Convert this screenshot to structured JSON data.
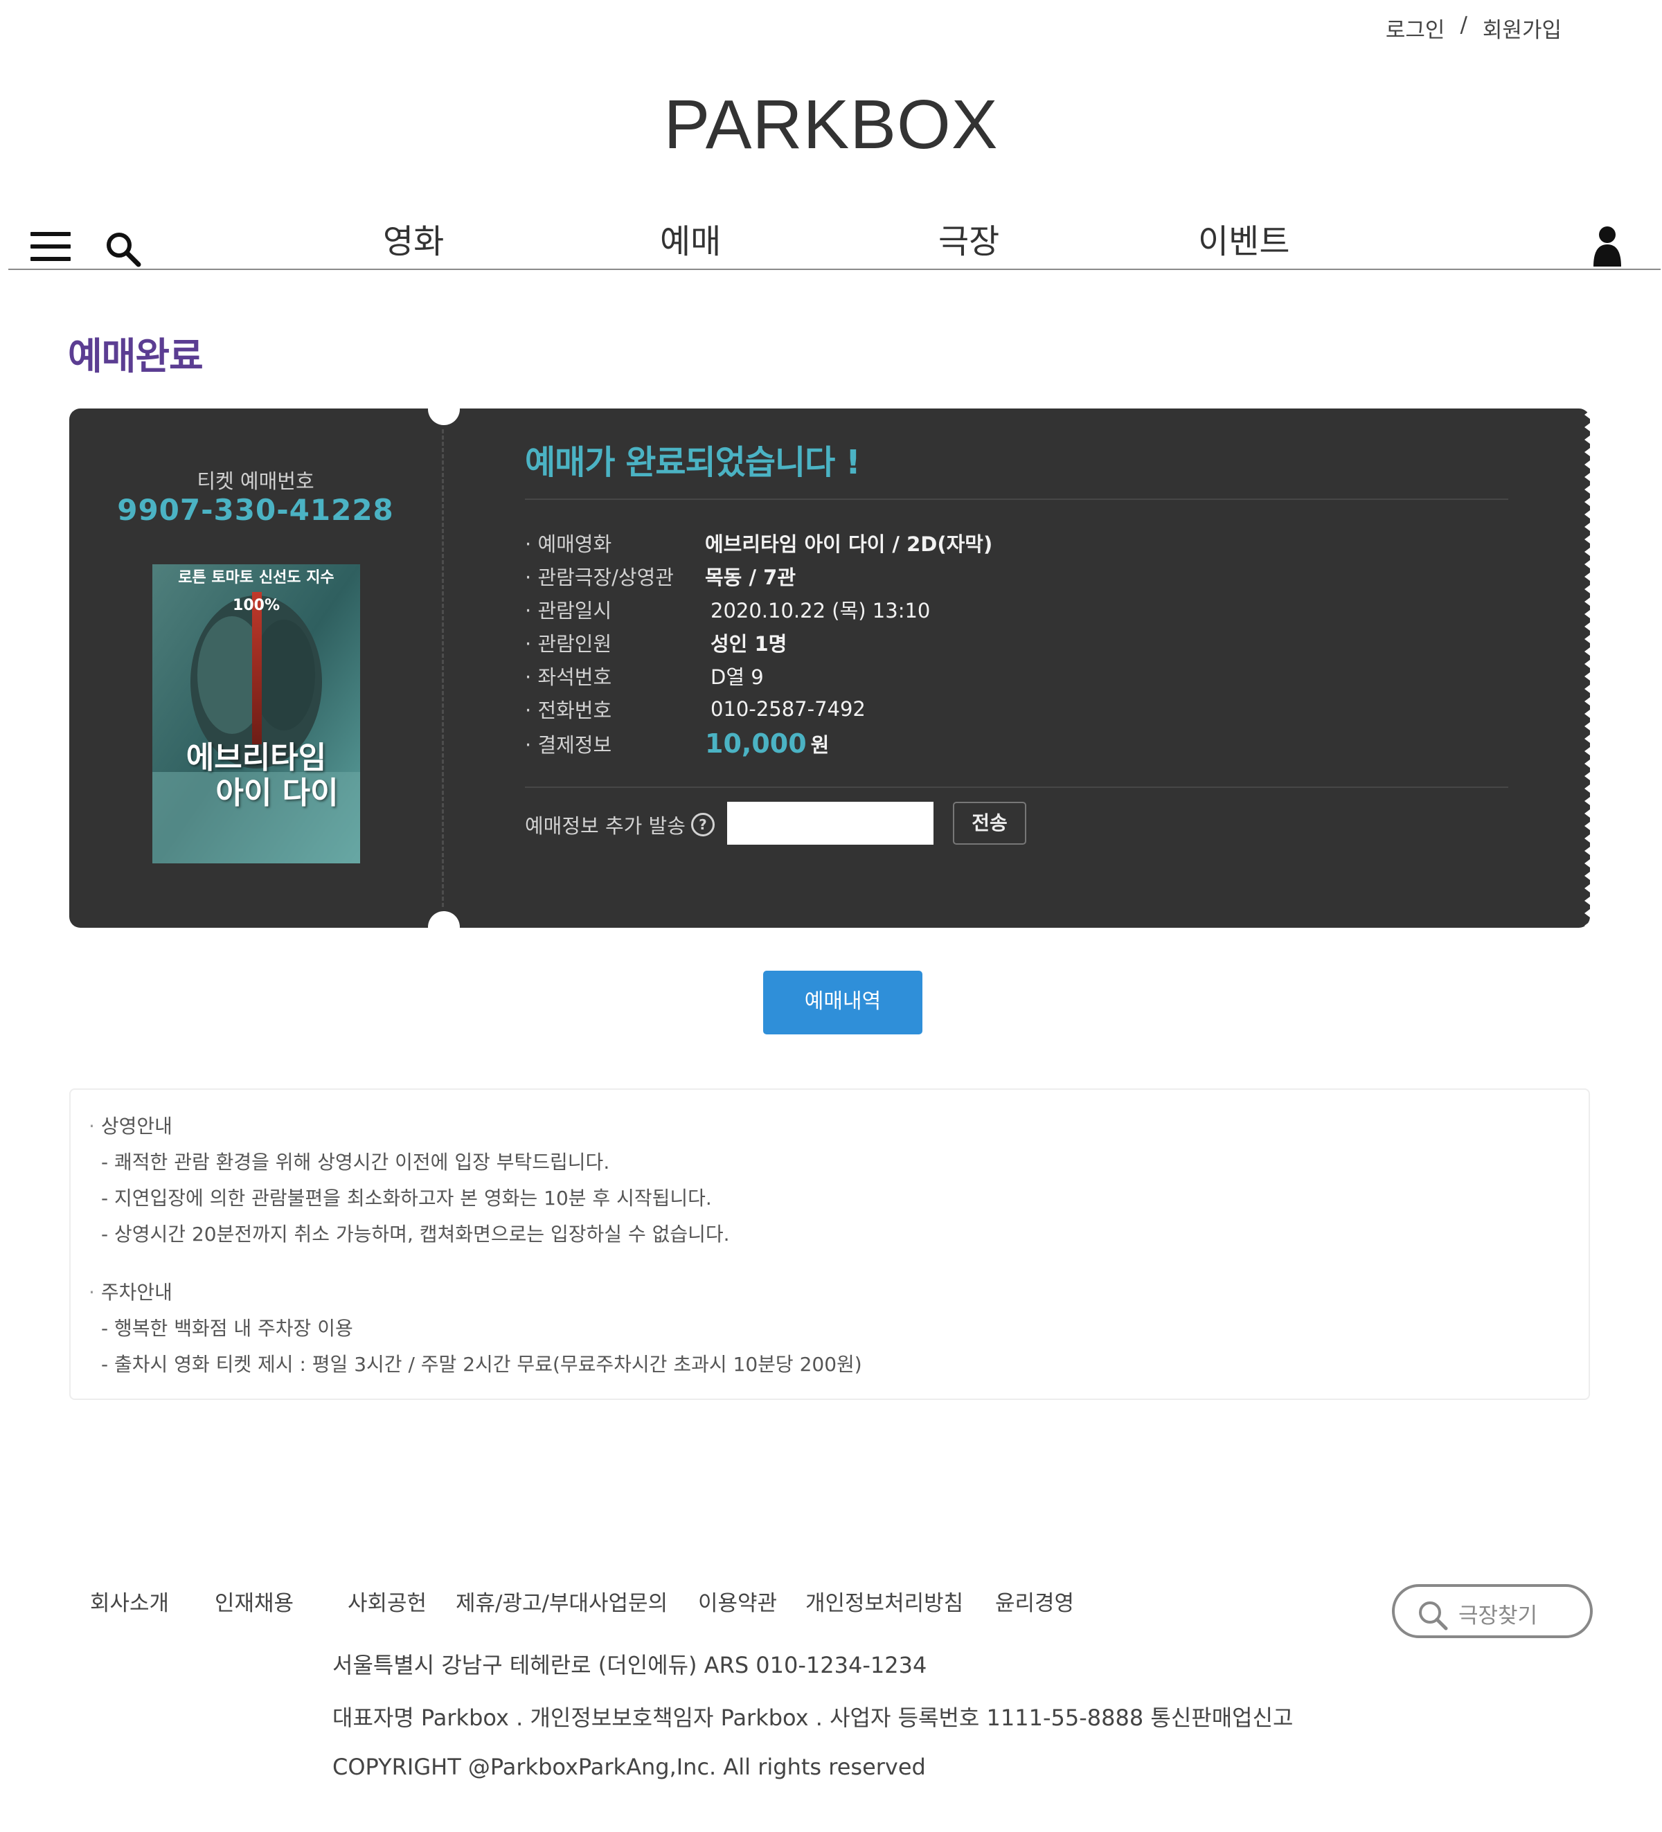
{
  "header": {
    "login": "로그인",
    "separator": "/",
    "signup": "회원가입",
    "logo": "PARKBOX"
  },
  "nav": {
    "items": [
      "영화",
      "예매",
      "극장",
      "이벤트"
    ]
  },
  "page": {
    "title": "예매완료"
  },
  "ticket": {
    "booking_label": "티켓 예매번호",
    "booking_number": "9907-330-41228",
    "poster_top_text": "로튼 토마토 신선도 지수 100%",
    "poster_title_line1": "에브리타임",
    "poster_title_line2": "아이 다이",
    "complete_message": "예매가 완료되었습니다 !",
    "rows": [
      {
        "label": "예매영화",
        "value": "에브리타임 아이 다이 / 2D(자막)"
      },
      {
        "label": "관람극장/상영관",
        "value": "목동 / 7관"
      },
      {
        "label": "관람일시",
        "value": "2020.10.22 (목) 13:10"
      },
      {
        "label": "관람인원",
        "value": "성인 1명"
      },
      {
        "label": "좌석번호",
        "value": "D열 9"
      },
      {
        "label": "전화번호",
        "value": "010-2587-7492"
      }
    ],
    "payment_label": "결제정보",
    "payment_amount": "10,000",
    "payment_unit": "원",
    "send_label": "예매정보 추가 발송",
    "send_input_value": "",
    "send_button": "전송",
    "accent_color": "#4bb3c4"
  },
  "history_button": "예매내역",
  "notice": {
    "screening_head": "상영안내",
    "screening_items": [
      "쾌적한 관람 환경을 위해 상영시간 이전에 입장 부탁드립니다.",
      "지연입장에 의한 관람불편을 최소화하고자 본 영화는 10분 후 시작됩니다.",
      "상영시간 20분전까지 취소 가능하며, 캡쳐화면으로는 입장하실 수 없습니다."
    ],
    "parking_head": "주차안내",
    "parking_items": [
      "행복한 백화점 내 주차장 이용",
      "출차시 영화 티켓 제시 : 평일 3시간 / 주말 2시간 무료(무료주차시간 초과시 10분당 200원)"
    ]
  },
  "footer": {
    "links": [
      "회사소개",
      "인재채용",
      "사회공헌",
      "제휴/광고/부대사업문의",
      "이용약관",
      "개인정보처리방침",
      "윤리경영"
    ],
    "address": "서울특별시 강남구 테헤란로 (더인에듀) ARS 010-1234-1234",
    "representative": "대표자명 Parkbox . 개인정보보호책임자 Parkbox . 사업자 등록번호 1111-55-8888 통신판매업신고",
    "copyright": "COPYRIGHT @ParkboxParkAng,Inc. All rights reserved",
    "theater_search": "극장찾기"
  }
}
